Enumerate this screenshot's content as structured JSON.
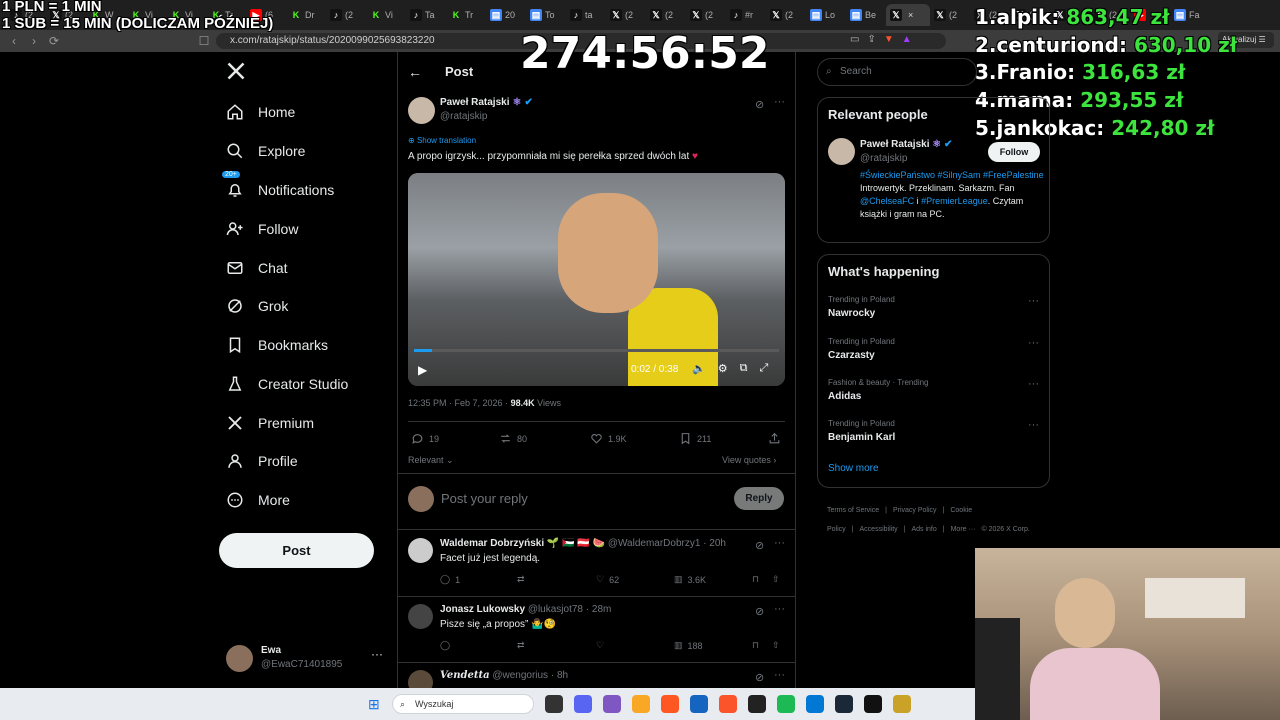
{
  "overlay": {
    "rate_line1": "1 PLN = 1 MIN",
    "rate_line2": "1 SUB = 15 MIN (DOLICZAM PÓŹNIEJ)",
    "timer": "274:56:52",
    "leaderboard": [
      {
        "rank": "1.",
        "name": "alpik:",
        "amount": "863,47 zł"
      },
      {
        "rank": "2.",
        "name": "centuriond:",
        "amount": "630,10 zł"
      },
      {
        "rank": "3.",
        "name": "Franio:",
        "amount": "316,63 zł"
      },
      {
        "rank": "4.",
        "name": "mama:",
        "amount": "293,55 zł"
      },
      {
        "rank": "5.",
        "name": "jankokac:",
        "amount": "242,80 zł"
      }
    ]
  },
  "browser": {
    "url": "x.com/ratajskip/status/2020099025693823220",
    "update_label": "Aktualizuj",
    "tabs": [
      {
        "icon": "tiktok",
        "label": "(2"
      },
      {
        "icon": "x",
        "label": "(2"
      },
      {
        "icon": "kick",
        "label": "W"
      },
      {
        "icon": "kick",
        "label": "Vi"
      },
      {
        "icon": "kick",
        "label": "Vi"
      },
      {
        "icon": "kick",
        "label": "Tr"
      },
      {
        "icon": "youtube",
        "label": "(6"
      },
      {
        "icon": "kick",
        "label": "Dr"
      },
      {
        "icon": "tiktok",
        "label": "(2"
      },
      {
        "icon": "kick",
        "label": "Vi"
      },
      {
        "icon": "tiktok",
        "label": "Ta"
      },
      {
        "icon": "kick",
        "label": "Tr"
      },
      {
        "icon": "doc",
        "label": "20"
      },
      {
        "icon": "doc",
        "label": "To"
      },
      {
        "icon": "tiktok",
        "label": "ta"
      },
      {
        "icon": "x",
        "label": "(2"
      },
      {
        "icon": "x",
        "label": "(2"
      },
      {
        "icon": "x",
        "label": "(2"
      },
      {
        "icon": "tiktok",
        "label": "#r"
      },
      {
        "icon": "x",
        "label": "(2"
      },
      {
        "icon": "doc",
        "label": "Lo"
      },
      {
        "icon": "doc",
        "label": "Be"
      },
      {
        "icon": "x",
        "label": ""
      },
      {
        "icon": "x",
        "label": "(2"
      },
      {
        "icon": "x",
        "label": "(2"
      },
      {
        "icon": "x",
        "label": "(2"
      },
      {
        "icon": "x",
        "label": "(2"
      },
      {
        "icon": "x",
        "label": "(2"
      },
      {
        "icon": "youtube",
        "label": ""
      },
      {
        "icon": "doc",
        "label": "Fa"
      }
    ]
  },
  "nav": {
    "items": [
      {
        "label": "Home",
        "icon": "home-icon"
      },
      {
        "label": "Explore",
        "icon": "search-icon"
      },
      {
        "label": "Notifications",
        "icon": "bell-icon",
        "badge": "20+"
      },
      {
        "label": "Follow",
        "icon": "person-add-icon"
      },
      {
        "label": "Chat",
        "icon": "mail-icon"
      },
      {
        "label": "Grok",
        "icon": "grok-icon"
      },
      {
        "label": "Bookmarks",
        "icon": "bookmark-icon"
      },
      {
        "label": "Creator Studio",
        "icon": "flask-icon"
      },
      {
        "label": "Premium",
        "icon": "x-icon"
      },
      {
        "label": "Profile",
        "icon": "person-icon"
      },
      {
        "label": "More",
        "icon": "more-circle-icon"
      }
    ],
    "post_label": "Post",
    "user": {
      "name": "Ewa",
      "handle": "@EwaC71401895"
    }
  },
  "post": {
    "header": "Post",
    "author": "Paweł Ratajski",
    "handle": "@ratajskip",
    "show_translation": "Show translation",
    "text": "A propo igrzysk... przypomniała mi się perełka sprzed dwóch lat",
    "video_time": "0:02 / 0:38",
    "video_progress": 0.05,
    "timestamp": "12:35 PM · Feb 7, 2026 ·",
    "views": "98.4K",
    "views_label": "Views",
    "replies": "19",
    "reposts": "80",
    "likes": "1.9K",
    "bookmarks": "211",
    "relevant": "Relevant",
    "view_quotes": "View quotes",
    "reply_placeholder": "Post your reply",
    "reply_button": "Reply"
  },
  "replies": [
    {
      "name": "Waldemar Dobrzyński",
      "emoji": "🌱 🇵🇸 🇦🇹 🍉",
      "handle": "@WaldemarDobrzy1 · 20h",
      "text": "Facet już jest legendą.",
      "replies": "1",
      "reposts": "",
      "likes": "62",
      "views": "3.6K"
    },
    {
      "name": "Jonasz Lukowsky",
      "emoji": "",
      "handle": "@lukasjot78 · 28m",
      "text": "Pisze się „a propos” 🤷‍♂️🧐",
      "replies": "",
      "reposts": "",
      "likes": "",
      "views": "188"
    },
    {
      "name": "Vendetta",
      "emoji": "",
      "handle": "@wengorius · 8h",
      "text": "",
      "replies": "",
      "reposts": "",
      "likes": "",
      "views": ""
    }
  ],
  "right": {
    "search_placeholder": "Search",
    "relevant_title": "Relevant people",
    "person": {
      "name": "Paweł Ratajski",
      "handle": "@ratajskip",
      "follow": "Follow",
      "bio_tags": "#ŚwieckiePaństwo #SilnySam #FreePalestine",
      "bio_text1": " Introwertyk. Przeklinam. Sarkazm. Fan ",
      "bio_mention": "@ChelseaFC",
      "bio_text2": " i ",
      "bio_tag2": "#PremierLeague",
      "bio_text3": ". Czytam książki i gram na PC."
    },
    "happening_title": "What's happening",
    "trends": [
      {
        "context": "Trending in Poland",
        "name": "Nawrocky"
      },
      {
        "context": "Trending in Poland",
        "name": "Czarzasty"
      },
      {
        "context": "Fashion & beauty · Trending",
        "name": "Adidas"
      },
      {
        "context": "Trending in Poland",
        "name": "Benjamin Karl"
      }
    ],
    "show_more": "Show more",
    "footer": [
      "Terms of Service",
      "|",
      "Privacy Policy",
      "|",
      "Cookie Policy",
      "|",
      "Accessibility",
      "|",
      "Ads info",
      "|",
      "More ···",
      "© 2026 X Corp."
    ]
  },
  "taskbar": {
    "search_placeholder": "Wyszukaj"
  }
}
